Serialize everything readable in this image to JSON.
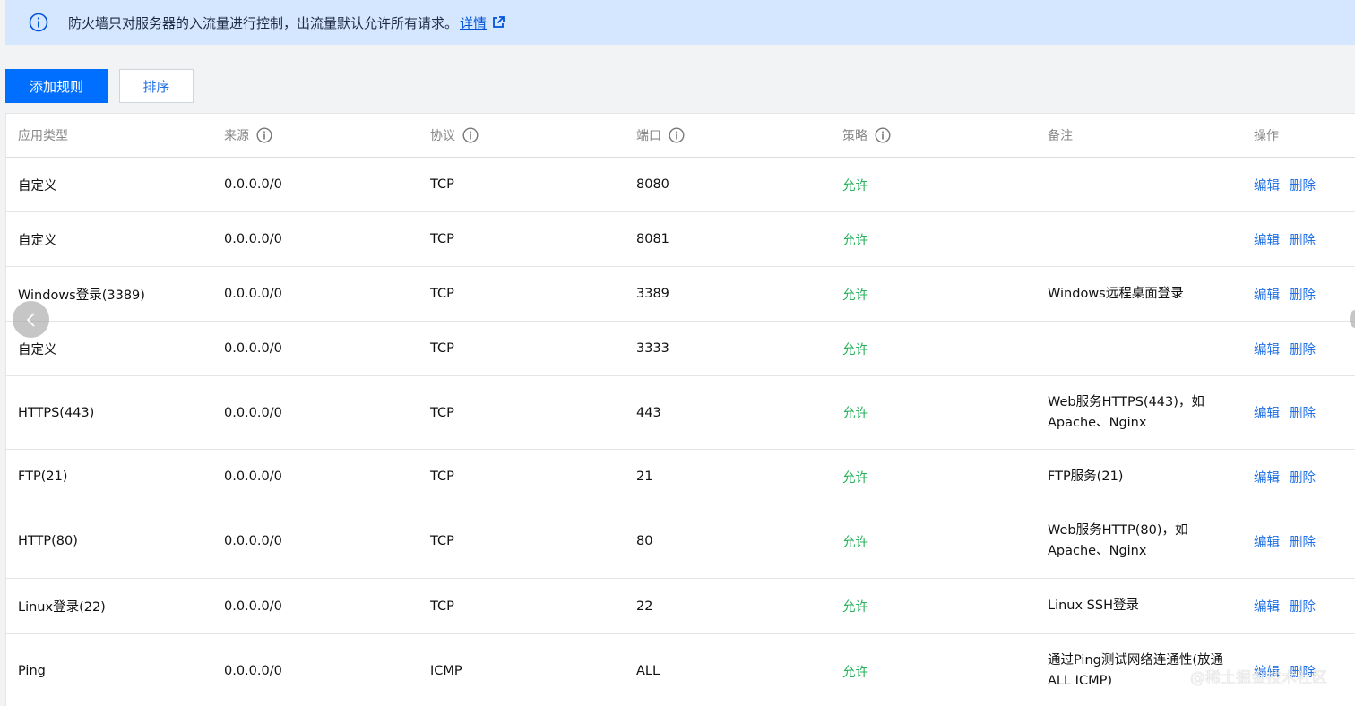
{
  "notice": {
    "text": "防火墙只对服务器的入流量进行控制，出流量默认允许所有请求。",
    "link_label": "详情"
  },
  "toolbar": {
    "add_label": "添加规则",
    "sort_label": "排序"
  },
  "table": {
    "headers": [
      "应用类型",
      "来源",
      "协议",
      "端口",
      "策略",
      "备注",
      "操作"
    ],
    "rows": [
      {
        "type": "自定义",
        "source": "0.0.0.0/0",
        "protocol": "TCP",
        "port": "8080",
        "policy": "允许",
        "note": "",
        "edit": "编辑",
        "delete": "删除"
      },
      {
        "type": "自定义",
        "source": "0.0.0.0/0",
        "protocol": "TCP",
        "port": "8081",
        "policy": "允许",
        "note": "",
        "edit": "编辑",
        "delete": "删除"
      },
      {
        "type": "Windows登录(3389)",
        "source": "0.0.0.0/0",
        "protocol": "TCP",
        "port": "3389",
        "policy": "允许",
        "note": "Windows远程桌面登录",
        "edit": "编辑",
        "delete": "删除"
      },
      {
        "type": "自定义",
        "source": "0.0.0.0/0",
        "protocol": "TCP",
        "port": "3333",
        "policy": "允许",
        "note": "",
        "edit": "编辑",
        "delete": "删除"
      },
      {
        "type": "HTTPS(443)",
        "source": "0.0.0.0/0",
        "protocol": "TCP",
        "port": "443",
        "policy": "允许",
        "note": "Web服务HTTPS(443)，如Apache、Nginx",
        "edit": "编辑",
        "delete": "删除"
      },
      {
        "type": "FTP(21)",
        "source": "0.0.0.0/0",
        "protocol": "TCP",
        "port": "21",
        "policy": "允许",
        "note": "FTP服务(21)",
        "edit": "编辑",
        "delete": "删除"
      },
      {
        "type": "HTTP(80)",
        "source": "0.0.0.0/0",
        "protocol": "TCP",
        "port": "80",
        "policy": "允许",
        "note": "Web服务HTTP(80)，如Apache、Nginx",
        "edit": "编辑",
        "delete": "删除"
      },
      {
        "type": "Linux登录(22)",
        "source": "0.0.0.0/0",
        "protocol": "TCP",
        "port": "22",
        "policy": "允许",
        "note": "Linux SSH登录",
        "edit": "编辑",
        "delete": "删除"
      },
      {
        "type": "Ping",
        "source": "0.0.0.0/0",
        "protocol": "ICMP",
        "port": "ALL",
        "policy": "允许",
        "note": "通过Ping测试网络连通性(放通ALL ICMP)",
        "edit": "编辑",
        "delete": "删除"
      }
    ]
  },
  "watermark": "@稀土掘金技术社区",
  "colors": {
    "primary": "#006eff",
    "link": "#1f6fe5",
    "allow": "#29b25d",
    "notice_bg": "#d5e7ff"
  }
}
